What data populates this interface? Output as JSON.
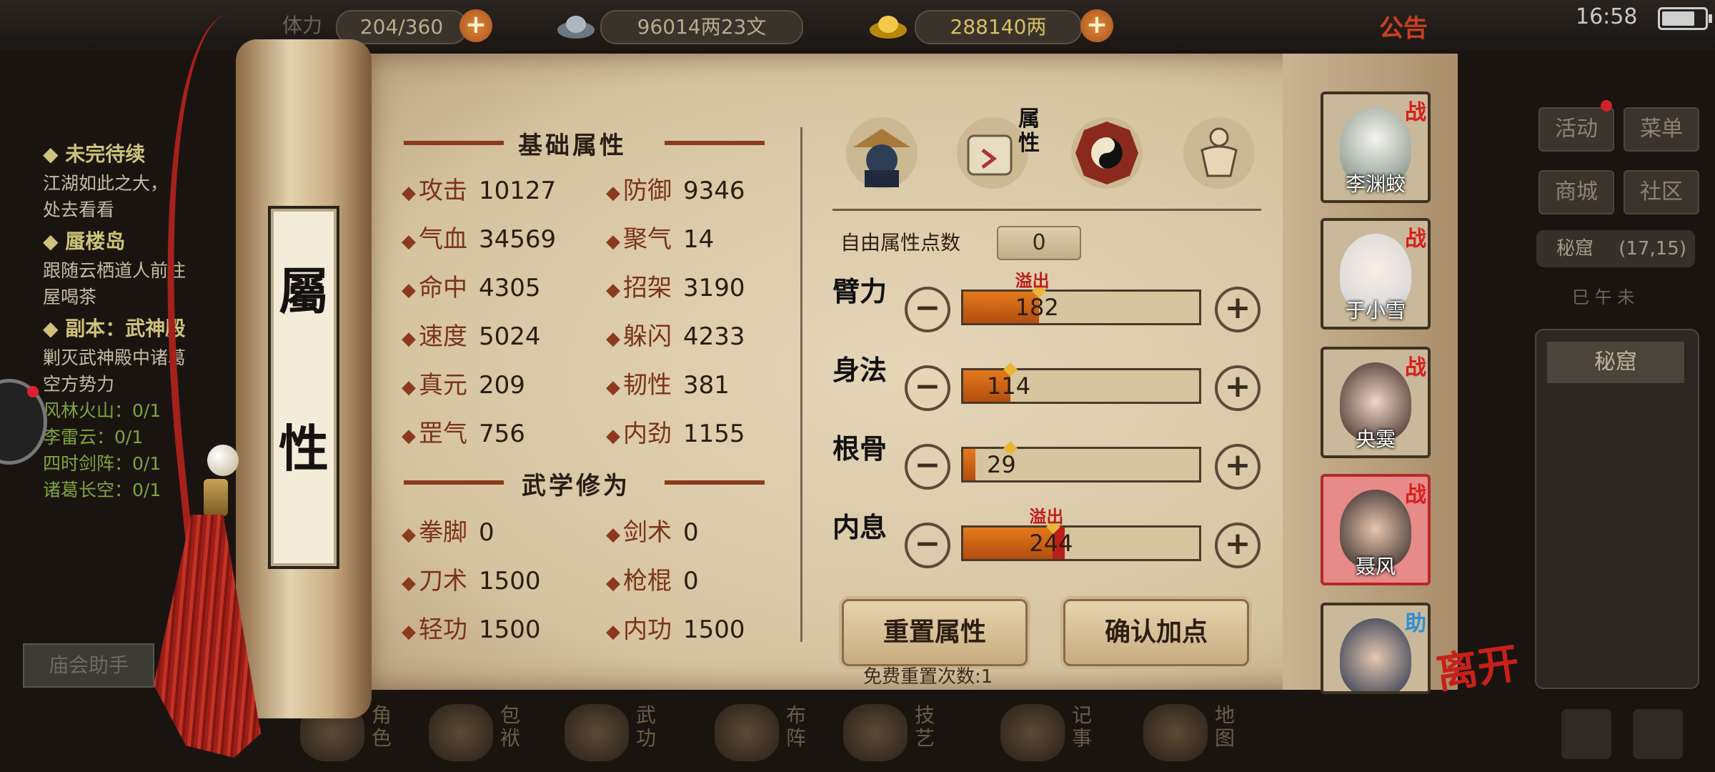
{
  "topbar": {
    "stamina": "204/360",
    "silver": "96014两23文",
    "gold": "288140两",
    "notice": "公告",
    "time": "16:58",
    "battery_level": 0.8
  },
  "quest": {
    "section1_title": "◆ 未完待续",
    "section1_line1": "江湖如此之大，",
    "section1_line2": "处去看看",
    "section2_title": "◆ 蜃楼岛",
    "section2_line1": "跟随云栖道人前往",
    "section2_line2": "屋喝茶",
    "section3_title": "◆ 副本：武神殿",
    "section3_line1": "剿灭武神殿中诸葛",
    "section3_line2": "空方势力",
    "prog1": "风林火山：0/1",
    "prog2": "李雷云：0/1",
    "prog3": "四时剑阵：0/1",
    "prog4": "诸葛长空：0/1",
    "helper": "庙会助手"
  },
  "right_menu": {
    "activity": "活动",
    "menu": "菜单",
    "mall": "商城",
    "community": "社区",
    "secret_loc": "秘窟",
    "secret_coord": "(17,15)",
    "zodiac": "巳 午 未",
    "secret_btn": "秘窟"
  },
  "bottom_nav": [
    "角色",
    "包袱",
    "武功",
    "布阵",
    "技艺",
    "记事",
    "地图"
  ],
  "scroll": {
    "char1": "屬",
    "char2": "性"
  },
  "basic": {
    "title": "基础属性",
    "stats": [
      {
        "name": "攻击",
        "value": "10127"
      },
      {
        "name": "防御",
        "value": "9346"
      },
      {
        "name": "气血",
        "value": "34569"
      },
      {
        "name": "聚气",
        "value": "14"
      },
      {
        "name": "命中",
        "value": "4305"
      },
      {
        "name": "招架",
        "value": "3190"
      },
      {
        "name": "速度",
        "value": "5024"
      },
      {
        "name": "躲闪",
        "value": "4233"
      },
      {
        "name": "真元",
        "value": "209"
      },
      {
        "name": "韧性",
        "value": "381"
      },
      {
        "name": "罡气",
        "value": "756"
      },
      {
        "name": "内劲",
        "value": "1155"
      }
    ]
  },
  "martial": {
    "title": "武学修为",
    "stats": [
      {
        "name": "拳脚",
        "value": "0"
      },
      {
        "name": "剑术",
        "value": "0"
      },
      {
        "name": "刀术",
        "value": "1500"
      },
      {
        "name": "枪棍",
        "value": "0"
      },
      {
        "name": "轻功",
        "value": "1500"
      },
      {
        "name": "内功",
        "value": "1500"
      }
    ]
  },
  "tabs": {
    "active_label": "属性"
  },
  "points": {
    "free_label": "自由属性点数",
    "free_value": "0",
    "overflow": "溢出",
    "attrs": [
      {
        "name": "臂力",
        "value": "182",
        "fill": 0.32,
        "red": 0.0,
        "overflow": true
      },
      {
        "name": "身法",
        "value": "114",
        "fill": 0.2,
        "red": 0.0,
        "overflow": false
      },
      {
        "name": "根骨",
        "value": "29",
        "fill": 0.05,
        "red": 0.0,
        "overflow": false
      },
      {
        "name": "内息",
        "value": "244",
        "fill": 0.38,
        "red": 0.05,
        "overflow": true
      }
    ]
  },
  "buttons": {
    "reset": "重置属性",
    "confirm": "确认加点",
    "free_reset": "免费重置次数:1"
  },
  "party": [
    {
      "name": "李渊蛟",
      "badge": "战"
    },
    {
      "name": "于小雪",
      "badge": "战"
    },
    {
      "name": "央霙",
      "badge": "战"
    },
    {
      "name": "聂风",
      "badge": "战"
    },
    {
      "name": "",
      "badge": "助"
    }
  ],
  "leave": "离开",
  "colors": {
    "accent": "#8b3a1e",
    "fight_badge": "#d81f1f",
    "assist_badge": "#2d8fd8",
    "bar_fill": "#e47a1b"
  }
}
